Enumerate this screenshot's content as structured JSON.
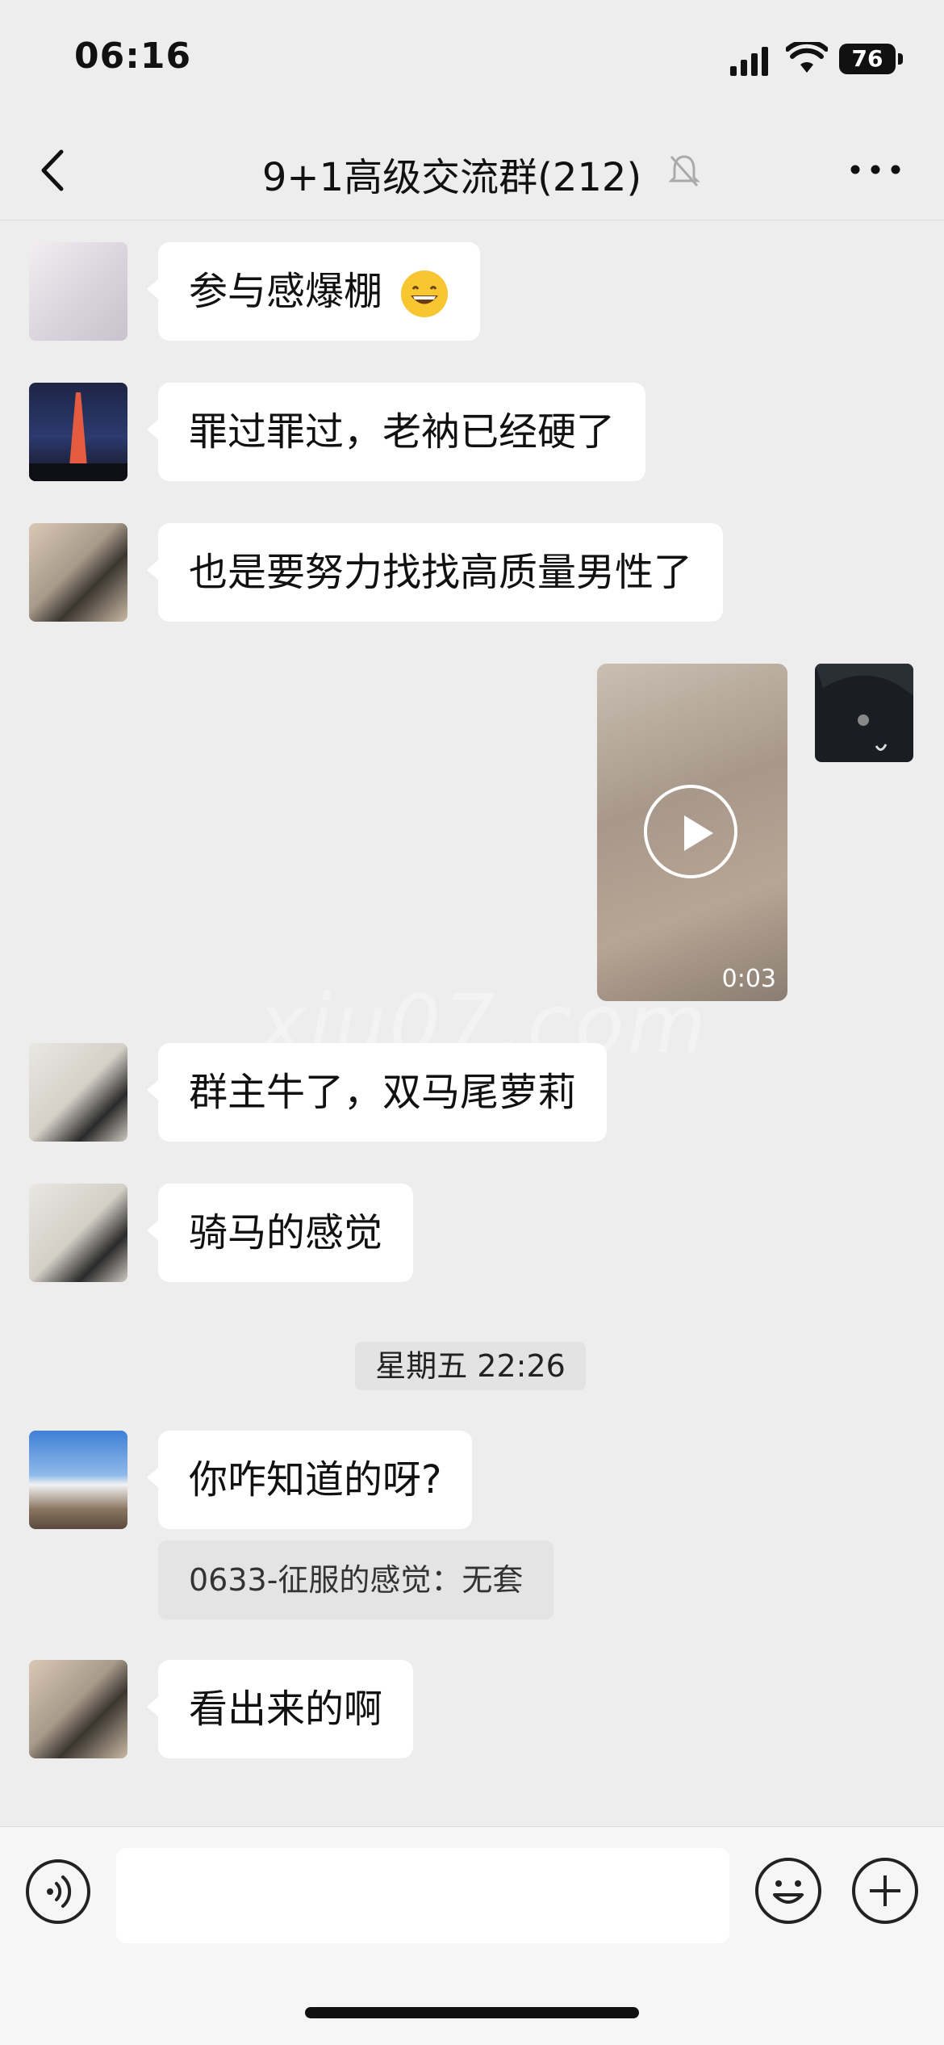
{
  "status_bar": {
    "time": "06:16",
    "battery": "76"
  },
  "header": {
    "title": "9+1高级交流群(212)",
    "icons": [
      "back-icon",
      "mute-bell-icon",
      "more-icon"
    ]
  },
  "messages": [
    {
      "type": "text",
      "text": "参与感爆棚",
      "emoji": "grinning-face"
    },
    {
      "type": "text",
      "text": "罪过罪过，老衲已经硬了"
    },
    {
      "type": "text",
      "text": "也是要努力找找高质量男性了"
    },
    {
      "type": "video",
      "duration": "0:03",
      "from_self": true
    },
    {
      "type": "text",
      "text": "群主牛了，双马尾萝莉"
    },
    {
      "type": "text",
      "text": "骑马的感觉"
    },
    {
      "type": "time",
      "text": "星期五 22:26"
    },
    {
      "type": "text",
      "text": "你咋知道的呀?",
      "quote": "0633-征服的感觉：无套"
    },
    {
      "type": "text",
      "text": "看出来的啊"
    }
  ],
  "watermark": "xiu07.com",
  "input_bar": {
    "placeholder": "",
    "icons": [
      "voice-icon",
      "emoji-icon",
      "plus-icon"
    ]
  }
}
